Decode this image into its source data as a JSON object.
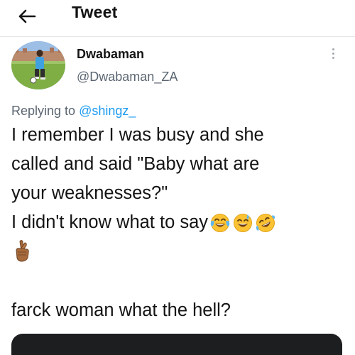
{
  "header": {
    "title": "Tweet",
    "back_icon": "arrow-left-icon"
  },
  "tweet": {
    "author": {
      "display_name": "Dwabaman",
      "handle": "@Dwabaman_ZA",
      "avatar": "avatar-photo"
    },
    "replying_to": {
      "prefix": "Replying to ",
      "mention": "@shingz_"
    },
    "body": {
      "line1": "I remember I was busy and she",
      "line2": "called and said \"Baby what are",
      "line3": "your weaknesses?\"",
      "line4": "I didn't know what to say",
      "line4_emojis": [
        "tears-of-joy-emoji",
        "grinning-sweat-emoji",
        "rofl-emoji"
      ],
      "line5_emoji": "crossed-fingers-emoji",
      "line6": "farck woman what the hell?"
    },
    "menu_icon": "more-vertical-icon"
  },
  "colors": {
    "link": "#1d9bf0",
    "secondary_text": "#5b6672",
    "primary_text": "#141414",
    "media_card": "#1d1e20"
  }
}
